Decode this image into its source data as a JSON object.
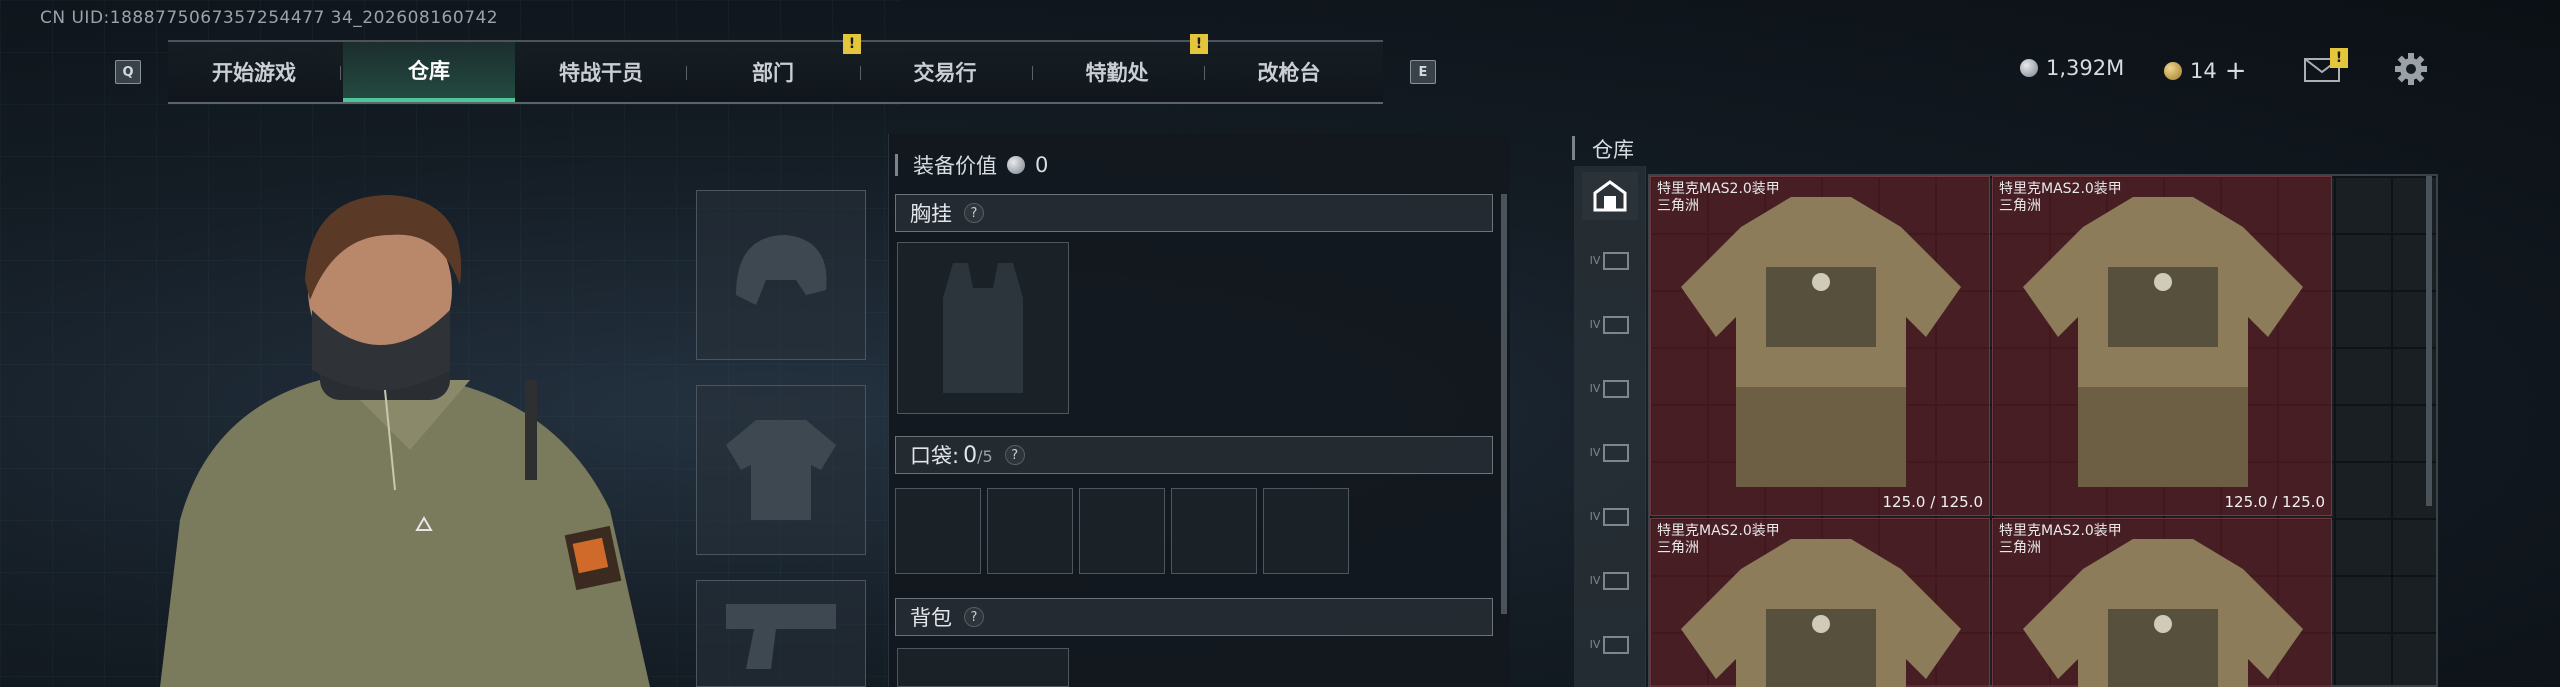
{
  "uid": "CN UID:1888775067357254477 34_202608160742",
  "nav": {
    "key_left": "Q",
    "key_right": "E",
    "items": [
      {
        "label": "开始游戏"
      },
      {
        "label": "仓库"
      },
      {
        "label": "特战干员"
      },
      {
        "label": "部门",
        "alert": "!"
      },
      {
        "label": "交易行"
      },
      {
        "label": "特勤处",
        "alert": "!"
      },
      {
        "label": "改枪台"
      }
    ]
  },
  "currency": {
    "silver": "1,392M",
    "gold": "14",
    "gold_add": "+",
    "mail_alert": "!"
  },
  "equipment": {
    "value_label": "装备价值",
    "value": "0",
    "chest_label": "胸挂",
    "pocket_label": "口袋:",
    "pocket_used": "0",
    "pocket_total": "/5",
    "backpack_label": "背包",
    "help": "?"
  },
  "storage": {
    "title": "仓库",
    "tab_tags": [
      "IV",
      "IV",
      "IV",
      "IV",
      "IV",
      "IV",
      "IV"
    ],
    "items": [
      {
        "name": "特里克MAS2.0装甲",
        "region": "三角洲",
        "durability": "125.0 / 125.0"
      },
      {
        "name": "特里克MAS2.0装甲",
        "region": "三角洲",
        "durability": "125.0 / 125.0"
      },
      {
        "name": "特里克MAS2.0装甲",
        "region": "三角洲",
        "durability": ""
      },
      {
        "name": "特里克MAS2.0装甲",
        "region": "三角洲",
        "durability": ""
      }
    ]
  },
  "colors": {
    "accent": "#4fc69a",
    "alert": "#e3c63c",
    "item_bg": "#6e1e26"
  }
}
